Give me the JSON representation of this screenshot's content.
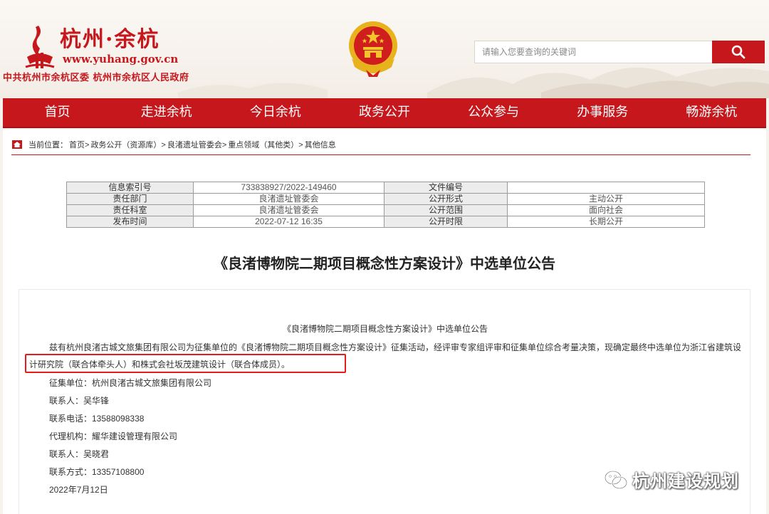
{
  "header": {
    "logo_name": "杭州·余杭",
    "logo_url": "www.yuhang.gov.cn",
    "org_names": "中共杭州市余杭区委  杭州市余杭区人民政府",
    "brand_color": "#c5171c"
  },
  "search": {
    "placeholder": "请输入您要查询的关键词"
  },
  "nav": {
    "items": [
      "首页",
      "走进余杭",
      "今日余杭",
      "政务公开",
      "公众参与",
      "办事服务",
      "畅游余杭"
    ]
  },
  "breadcrumb": {
    "prefix": "当前位置：",
    "items": [
      "首页>",
      "政务公开（资源库）>",
      "良渚遗址管委会>",
      "重点领域（其他类）>",
      "其他信息"
    ]
  },
  "meta_table": {
    "rows": [
      [
        "信息索引号",
        "733838927/2022-149460",
        "文件编号",
        ""
      ],
      [
        "责任部门",
        "良渚遗址管委会",
        "公开形式",
        "主动公开"
      ],
      [
        "责任科室",
        "良渚遗址管委会",
        "公开范围",
        "面向社会"
      ],
      [
        "发布时间",
        "2022-07-12 16:35",
        "公开时限",
        "长期公开"
      ]
    ]
  },
  "document": {
    "title": "《良渚博物院二期项目概念性方案设计》中选单位公告",
    "content_title": "《良渚博物院二期项目概念性方案设计》中选单位公告",
    "paragraph": "兹有杭州良渚古城文旅集团有限公司为征集单位的《良渚博物院二期项目概念性方案设计》征集活动，经评审专家组评审和征集单位综合考量决策，现确定最终中选单位为浙江省建筑设计研究院（联合体牵头人）和株式会社坂茂建筑设计（联合体成员）。",
    "lines": [
      "征集单位：杭州良渚古城文旅集团有限公司",
      "联系人：吴华锋",
      "联系电话：13588098338",
      "代理机构：耀华建设管理有限公司",
      "联系人：吴晓君",
      "联系方式：13357108800",
      "2022年7月12日"
    ]
  },
  "watermark": {
    "text": "杭州建设规划"
  }
}
